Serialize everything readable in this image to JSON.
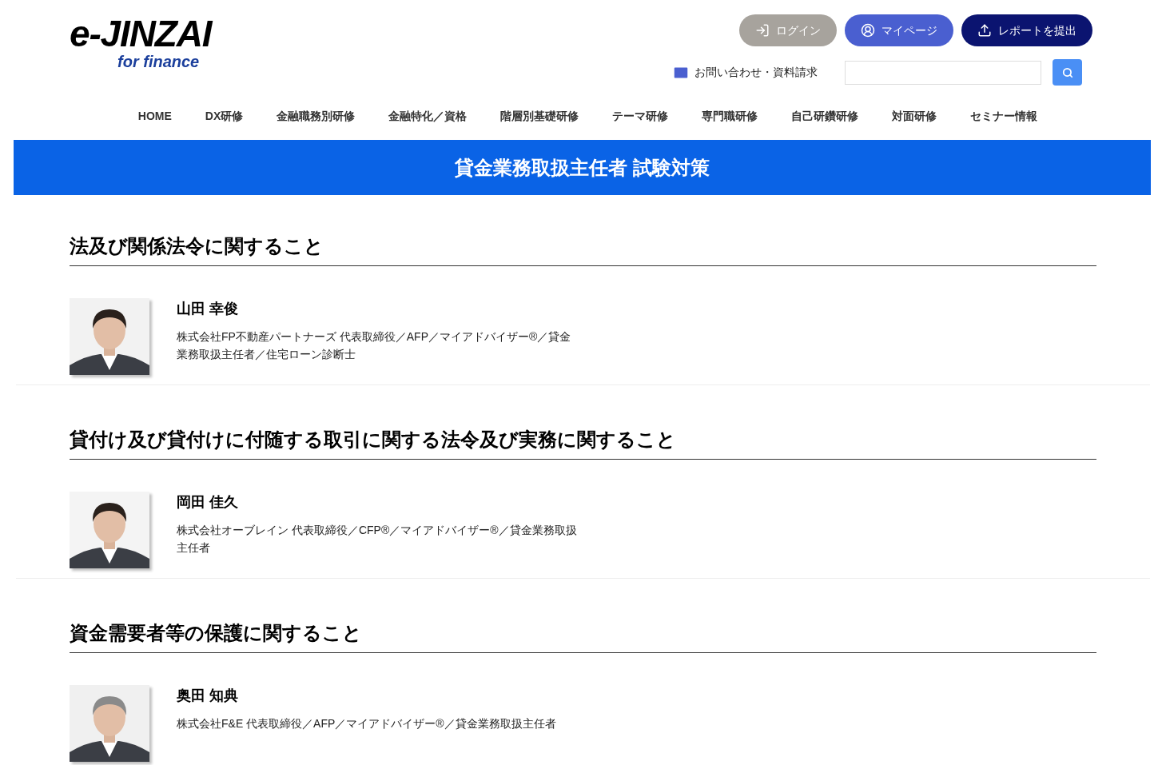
{
  "logo": {
    "title": "e-JINZAI",
    "tagline": "for finance"
  },
  "header_buttons": [
    {
      "kind": "login",
      "label": "ログイン"
    },
    {
      "kind": "mypage",
      "label": "マイページ"
    },
    {
      "kind": "report",
      "label": "レポートを提出"
    }
  ],
  "contact_link": "お問い合わせ・資料請求",
  "nav": [
    "HOME",
    "DX研修",
    "金融職務別研修",
    "金融特化／資格",
    "階層別基礎研修",
    "テーマ研修",
    "専門職研修",
    "自己研鑽研修",
    "対面研修",
    "セミナー情報"
  ],
  "banner": "貸金業務取扱主任者 試験対策",
  "sections": [
    {
      "heading": "法及び関係法令に関すること",
      "instructor": {
        "name": "山田 幸俊",
        "profile": "株式会社FP不動産パートナーズ 代表取締役／AFP／マイアドバイザー®／貸金業務取扱主任者／住宅ローン診断士"
      }
    },
    {
      "heading": "貸付け及び貸付けに付随する取引に関する法令及び実務に関すること",
      "instructor": {
        "name": "岡田 佳久",
        "profile": "株式会社オーブレイン 代表取締役／CFP®／マイアドバイザー®／貸金業務取扱主任者"
      }
    },
    {
      "heading": "資金需要者等の保護に関すること",
      "instructor": {
        "name": "奥田 知典",
        "profile": "株式会社F&E 代表取締役／AFP／マイアドバイザー®／貸金業務取扱主任者"
      }
    }
  ]
}
